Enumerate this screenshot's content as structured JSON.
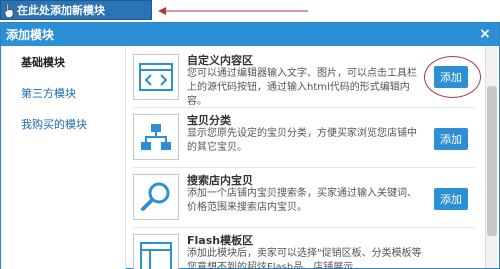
{
  "top": {
    "add_here_label": "在此处添加新模块"
  },
  "dialog": {
    "title": "添加模块",
    "close_glyph": "×"
  },
  "sidebar": {
    "items": [
      {
        "label": "基础模块",
        "active": true
      },
      {
        "label": "第三方模块",
        "active": false
      },
      {
        "label": "我购买的模块",
        "active": false
      }
    ]
  },
  "modules": [
    {
      "title": "自定义内容区",
      "desc": "您可以通过编辑器输入文字、图片，可以点击工具栏上的源代码按钮，通过输入html代码的形式编辑内容。",
      "button": "添加",
      "icon": "code-icon"
    },
    {
      "title": "宝贝分类",
      "desc": "显示您原先设定的宝贝分类，方便买家浏览您店铺中的其它宝贝。",
      "button": "添加",
      "icon": "category-tree-icon"
    },
    {
      "title": "搜索店内宝贝",
      "desc": "添加一个店铺内宝贝搜索条，买家通过输入关键词、价格范围来搜索店内宝贝。",
      "button": "添加",
      "icon": "search-icon"
    },
    {
      "title": "Flash模板区",
      "desc": "添加此模块后，卖家可以选择\"促销区板、分类模板等您意想不到的超炫Flash品、店铺展示",
      "button": "",
      "icon": "layout-icon"
    }
  ],
  "colors": {
    "accent": "#2d8fd5",
    "annotation": "#b53636"
  }
}
